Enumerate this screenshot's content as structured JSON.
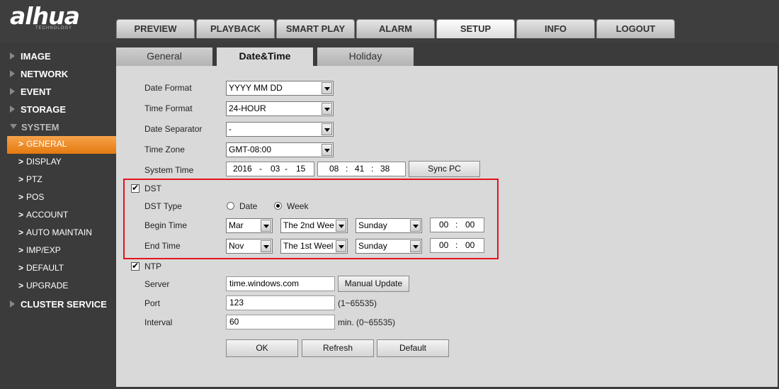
{
  "logo": {
    "brand": "alhua",
    "tagline": "TECHNOLOGY"
  },
  "topnav": [
    {
      "label": "PREVIEW"
    },
    {
      "label": "PLAYBACK"
    },
    {
      "label": "SMART PLAY"
    },
    {
      "label": "ALARM"
    },
    {
      "label": "SETUP",
      "active": true
    },
    {
      "label": "INFO"
    },
    {
      "label": "LOGOUT"
    }
  ],
  "sidebar": {
    "image": "IMAGE",
    "network": "NETWORK",
    "event": "EVENT",
    "storage": "STORAGE",
    "system": "SYSTEM",
    "system_items": [
      "GENERAL",
      "DISPLAY",
      "PTZ",
      "POS",
      "ACCOUNT",
      "AUTO MAINTAIN",
      "IMP/EXP",
      "DEFAULT",
      "UPGRADE"
    ],
    "cluster": "CLUSTER SERVICE"
  },
  "subtabs": [
    "General",
    "Date&Time",
    "Holiday"
  ],
  "form": {
    "date_format": {
      "label": "Date Format",
      "value": "YYYY MM DD"
    },
    "time_format": {
      "label": "Time Format",
      "value": "24-HOUR"
    },
    "date_separator": {
      "label": "Date Separator",
      "value": "-"
    },
    "time_zone": {
      "label": "Time Zone",
      "value": "GMT-08:00"
    },
    "system_time": {
      "label": "System Time",
      "year": "2016",
      "month": "03",
      "day": "15",
      "hour": "08",
      "minute": "41",
      "second": "38",
      "sep_date": "-",
      "sep_time": ":"
    },
    "sync_pc": "Sync PC",
    "dst": {
      "label": "DST",
      "checked": true
    },
    "dst_type": {
      "label": "DST Type",
      "option_date": "Date",
      "option_week": "Week",
      "selected": "Week"
    },
    "begin_time": {
      "label": "Begin Time",
      "month": "Mar",
      "week": "The 2nd Wee",
      "day": "Sunday",
      "hour": "00",
      "minute": "00"
    },
    "end_time": {
      "label": "End Time",
      "month": "Nov",
      "week": "The 1st Weel",
      "day": "Sunday",
      "hour": "00",
      "minute": "00"
    },
    "ntp": {
      "label": "NTP",
      "checked": true
    },
    "server": {
      "label": "Server",
      "value": "time.windows.com"
    },
    "manual_update": "Manual Update",
    "port": {
      "label": "Port",
      "value": "123",
      "hint": "(1~65535)"
    },
    "interval": {
      "label": "Interval",
      "value": "60",
      "hint": "min. (0~65535)"
    },
    "ok": "OK",
    "refresh": "Refresh",
    "default": "Default"
  },
  "colors": {
    "accent": "#e47a10",
    "highlight": "#e4131b",
    "panel": "#d9d9d9",
    "chrome": "#3b3b3b"
  }
}
